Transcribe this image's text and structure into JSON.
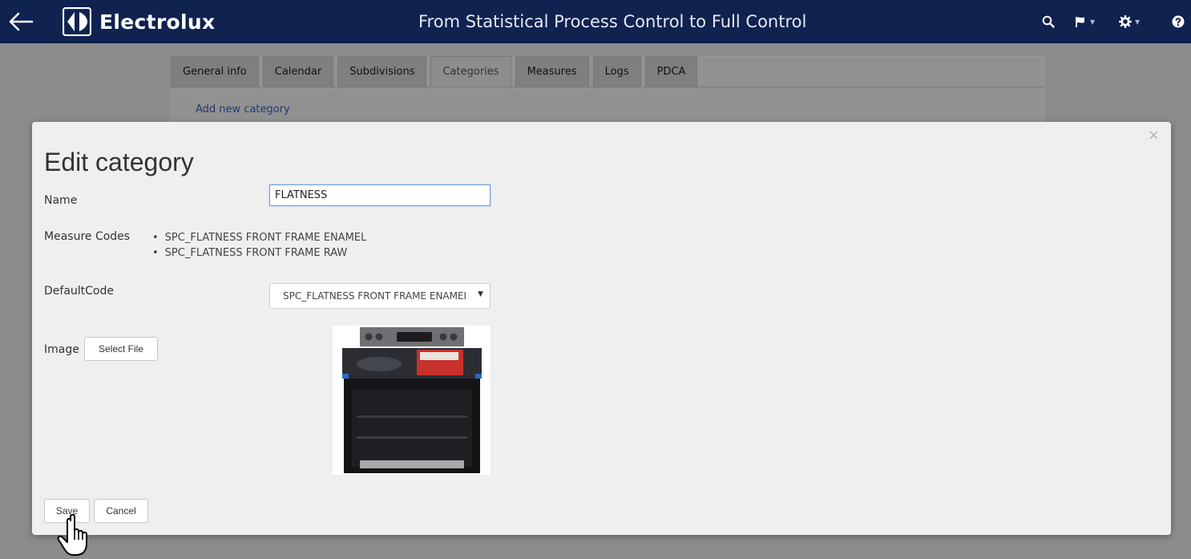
{
  "header": {
    "brand": "Electrolux",
    "title": "From Statistical Process Control to Full Control",
    "icons": [
      "arrow-left-icon",
      "electrolux-logo-icon",
      "search-icon",
      "flag-icon",
      "gear-icon",
      "help-icon"
    ]
  },
  "tabs": [
    {
      "label": "General info"
    },
    {
      "label": "Calendar"
    },
    {
      "label": "Subdivisions"
    },
    {
      "label": "Categories",
      "active": true
    },
    {
      "label": "Measures"
    },
    {
      "label": "Logs"
    },
    {
      "label": "PDCA"
    }
  ],
  "categories_page": {
    "add_link": "Add new category"
  },
  "modal": {
    "title": "Edit category",
    "close": "×",
    "name_label": "Name",
    "name_value": "FLATNESS",
    "measure_codes_label": "Measure Codes",
    "measure_codes": [
      "SPC_FLATNESS FRONT FRAME ENAMEL",
      "SPC_FLATNESS FRONT FRAME RAW"
    ],
    "default_code_label": "DefaultCode",
    "default_code_value": "SPC_FLATNESS FRONT FRAME ENAMEL",
    "image_label": "Image",
    "select_file": "Select File",
    "save": "Save",
    "cancel": "Cancel"
  },
  "colors": {
    "header_bg": "#0f2250",
    "overlay": "#8c8c8c",
    "modal_bg": "#efefef",
    "link": "#1f3a72",
    "input_focus": "#6f9fd8"
  }
}
